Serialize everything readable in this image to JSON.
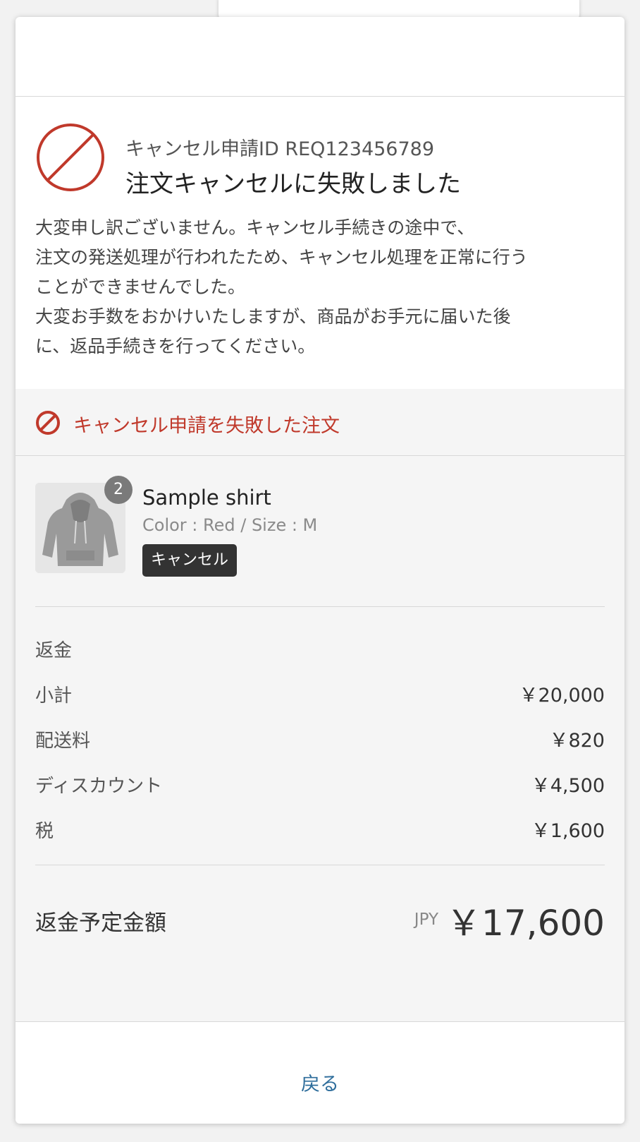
{
  "status": {
    "request_id": "キャンセル申請ID REQ123456789",
    "headline": "注文キャンセルに失敗しました"
  },
  "message": {
    "lines": [
      "大変申し訳ございません。キャンセル手続きの途中で、",
      "注文の発送処理が行われたため、キャンセル処理を正常に行う",
      "ことができませんでした。",
      "大変お手数をおかけいたしますが、商品がお手元に届いた後",
      "に、返品手続きを行ってください。"
    ]
  },
  "failed_orders": {
    "title": "キャンセル申請を失敗した注文",
    "item": {
      "quantity": "2",
      "name": "Sample shirt",
      "variant": "Color : Red / Size : M",
      "tag": "キャンセル",
      "image_icon": "hoodie-image"
    }
  },
  "refund": {
    "heading": "返金",
    "rows": [
      {
        "label": "小計",
        "amount": "￥20,000"
      },
      {
        "label": "配送料",
        "amount": "￥820"
      },
      {
        "label": "ディスカウント",
        "amount": "￥4,500"
      },
      {
        "label": "税",
        "amount": "￥1,600"
      }
    ]
  },
  "total": {
    "label": "返金予定金額",
    "currency": "JPY",
    "amount": "￥17,600"
  },
  "footer": {
    "back_label": "戻る"
  },
  "colors": {
    "error": "#c0392b",
    "link": "#2f6e9c",
    "section_bg": "#f5f5f5"
  }
}
